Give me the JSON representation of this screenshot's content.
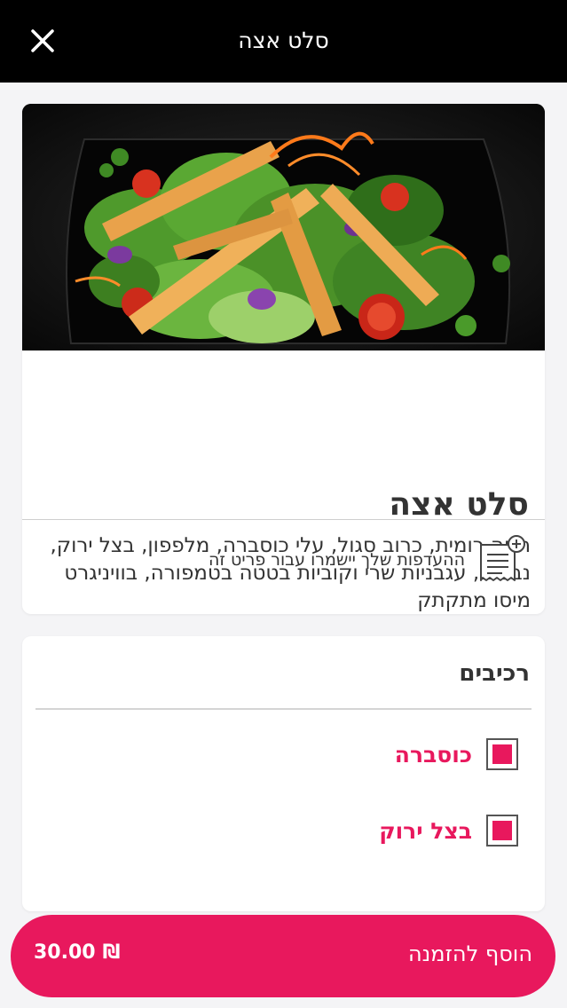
{
  "header": {
    "title": "סלט אצה",
    "close_icon": "close-icon"
  },
  "item": {
    "name": "סלט אצה",
    "description": "חסה רומית, כרוב סגול, עלי כוסברה, מלפפון, בצל ירוק, נבטים, עגבניות שרי וקוביות בטטה בטמפורה, בוויניגרט מיסו מתקתק",
    "notes_icon": "receipt-add-icon",
    "notes_text": "ההעדפות שלך יישמרו עבור פריט זה"
  },
  "ingredients": {
    "title": "רכיבים",
    "items": [
      {
        "label": "כוסברה",
        "checked": true
      },
      {
        "label": "בצל ירוק",
        "checked": true
      }
    ]
  },
  "order_button": {
    "label": "הוסף להזמנה",
    "price": "30.00",
    "currency": "₪"
  },
  "colors": {
    "accent": "#e8185d",
    "header_bg": "#000000",
    "page_bg": "#f4f4f6"
  }
}
